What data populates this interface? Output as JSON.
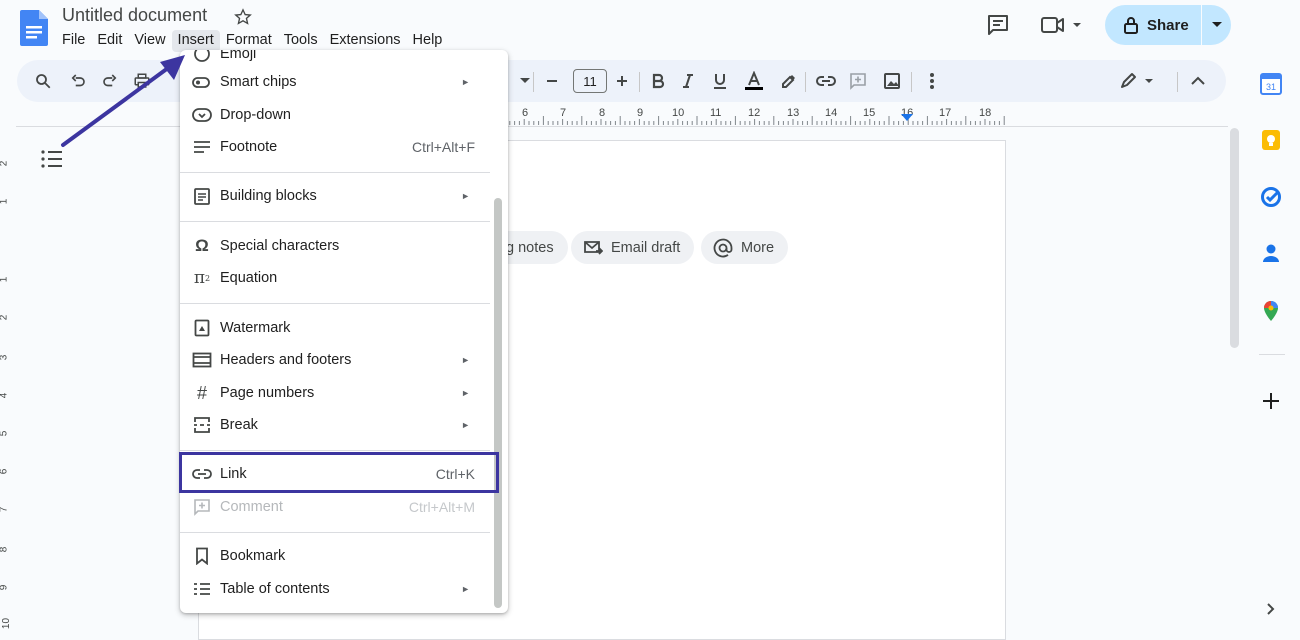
{
  "header": {
    "title": "Untitled document",
    "menu": [
      "File",
      "Edit",
      "View",
      "Insert",
      "Format",
      "Tools",
      "Extensions",
      "Help"
    ],
    "share_label": "Share"
  },
  "toolbar": {
    "font_size": "11"
  },
  "ruler": {
    "numbers": [
      "6",
      "7",
      "8",
      "9",
      "10",
      "11",
      "12",
      "13",
      "14",
      "15",
      "16",
      "17",
      "18"
    ]
  },
  "vertical_ruler": {
    "numbers": [
      "2",
      "1",
      "1",
      "2",
      "3",
      "4",
      "5",
      "6",
      "7",
      "8",
      "9",
      "10"
    ]
  },
  "document": {
    "chips": [
      {
        "label": "g notes"
      },
      {
        "label": "Email draft"
      },
      {
        "label": "More"
      }
    ]
  },
  "insert_menu": {
    "items": [
      {
        "label": "Emoji",
        "shortcut": "",
        "submenu": false,
        "disabled": false
      },
      {
        "label": "Smart chips",
        "shortcut": "",
        "submenu": true,
        "disabled": false
      },
      {
        "label": "Drop-down",
        "shortcut": "",
        "submenu": false,
        "disabled": false
      },
      {
        "label": "Footnote",
        "shortcut": "Ctrl+Alt+F",
        "submenu": false,
        "disabled": false
      },
      {
        "label": "Building blocks",
        "shortcut": "",
        "submenu": true,
        "disabled": false
      },
      {
        "label": "Special characters",
        "shortcut": "",
        "submenu": false,
        "disabled": false
      },
      {
        "label": "Equation",
        "shortcut": "",
        "submenu": false,
        "disabled": false
      },
      {
        "label": "Watermark",
        "shortcut": "",
        "submenu": false,
        "disabled": false
      },
      {
        "label": "Headers and footers",
        "shortcut": "",
        "submenu": true,
        "disabled": false
      },
      {
        "label": "Page numbers",
        "shortcut": "",
        "submenu": true,
        "disabled": false
      },
      {
        "label": "Break",
        "shortcut": "",
        "submenu": true,
        "disabled": false
      },
      {
        "label": "Link",
        "shortcut": "Ctrl+K",
        "submenu": false,
        "disabled": false
      },
      {
        "label": "Comment",
        "shortcut": "Ctrl+Alt+M",
        "submenu": false,
        "disabled": true
      },
      {
        "label": "Bookmark",
        "shortcut": "",
        "submenu": false,
        "disabled": false
      },
      {
        "label": "Table of contents",
        "shortcut": "",
        "submenu": true,
        "disabled": false
      }
    ]
  },
  "colors": {
    "share_bg": "#c2e7ff",
    "toolbar_bg": "#edf2fa",
    "highlight_box": "#3c35a0",
    "annotation_arrow": "#3c35a0"
  }
}
